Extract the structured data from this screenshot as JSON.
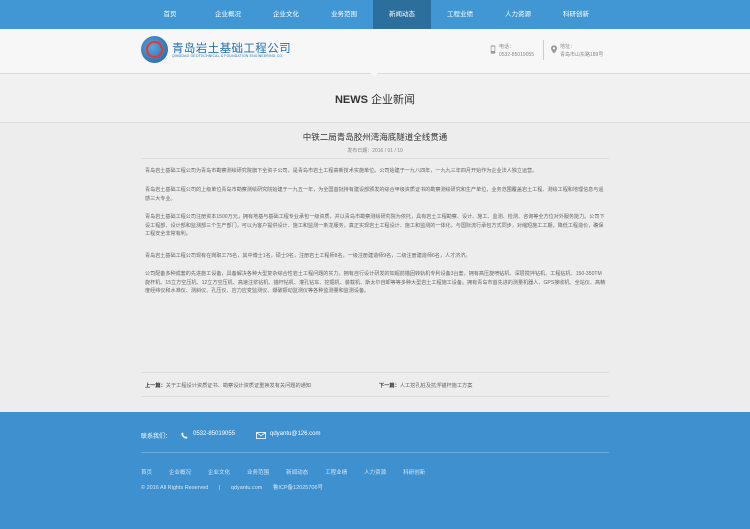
{
  "nav": {
    "items": [
      "首页",
      "企业概况",
      "企业文化",
      "业务范围",
      "新闻动态",
      "工程业绩",
      "人力资源",
      "科研创新"
    ],
    "active_index": 4
  },
  "header": {
    "company_name": "青岛岩土基础工程公司",
    "company_name_en": "QINGDAO GEOTECHNICAL & FOUNDATION ENGINEERING CO.",
    "phone_label": "电话：",
    "phone": "0532-85019055",
    "address_label": "地址：",
    "address": "青岛市山东路189号"
  },
  "banner": {
    "title_en": "NEWS",
    "title_cn": "企业新闻"
  },
  "article": {
    "title": "中铁二局青岛胶州湾海底隧道全线贯通",
    "date": "发布日期：2016 / 01 / 19",
    "paragraphs": [
      "青岛岩土基础工程公司为青岛市勘察测绘研究院旗下全资子公司，是青岛市岩土工程高新技术实施单位。公司始建于一九八四年，一九九三年四月开始作为企业法人独立运营。",
      "青岛岩土基础工程公司的上级单位青岛市勘察测绘研究院始建于一九五一年，为全国首批持有建设部颁发的综合甲级资质证书的勘察测绘研究和生产单位，业务范围覆盖岩土工程、测绘工程和地理信息与遥感三大专业。",
      "青岛岩土基础工程公司注册资本1500万元，拥有地基与基础工程专业承包一级资质，并以青岛市勘察测绘研究院为依托，具有岩土工程勘察、设计、施工、监测、检测、咨询等全方位对外服务能力。公司下设工程部、设计部和监测部三个生产部门，可以为客户提供设计、施工和监测一条龙服务，真正实现岩土工程设计、施工和监测的一体化，与国际流行承包方式同步，对缩短施工工期，降低工程造价，确保工程安全非常有利。",
      "青岛岩土基础工程公司现有在岗职工75名，其中博士1名，硕士9名，注册岩土工程师8名，一级注册建造师9名，二级注册建造师6名，人才济济。",
      "公司配备多种成套的先进施工设备，具备解决各种大型复杂综合性岩土工程问题的实力。拥有自行设计研发的如超前锚固转轨机专利设备3台套，拥有高压旋喷钻机、深层搅拌钻机、工程钻机、150-350TM旋杆机、15立方空压机、12立方空压机、高速注浆钻机、锚杆钻机、灌孔钻车、挖掘机、装载机、斯太尔自卸等等多种大型岩土工程施工设备。拥有青岛市首先进的测量机器人、GPS接收机、全站仪、高精度经纬仪和水准仪、测斜仪、孔压仪、应力应变监测仪、爆破振动监测仪等各种监测量和监测设备。"
    ]
  },
  "prev_next": {
    "prev_label": "上一篇：",
    "prev_title": "关于工程设计资质证书、勘察设计资质证重换发有关问题的通知",
    "next_label": "下一篇：",
    "next_title": "人工挖孔桩及抗浮锚杆施工方案"
  },
  "footer": {
    "contact_label": "联系我们：",
    "phone": "0532-85019055",
    "email": "qdyantu@126.com",
    "links": [
      "首页",
      "企业概况",
      "企业文化",
      "业务范围",
      "新闻动态",
      "工程业绩",
      "人力资源",
      "科研创新"
    ],
    "copyright": "© 2016 All Rights Reserved",
    "separator": "|",
    "domain": "qdyantu.com",
    "icp": "鲁ICP备12025706号"
  },
  "colors": {
    "nav_bg": "#4197d3",
    "nav_active": "#2d6f9c",
    "footer_bg": "#3e90ce",
    "brand_blue": "#1f6fb3"
  }
}
